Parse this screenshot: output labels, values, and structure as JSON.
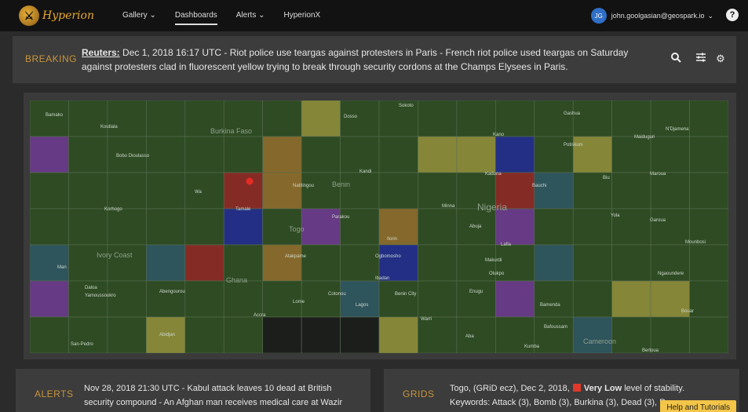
{
  "app": {
    "logo_text": "Hyperion"
  },
  "nav": [
    {
      "label": "Gallery",
      "dropdown": true
    },
    {
      "label": "Dashboards",
      "active": true
    },
    {
      "label": "Alerts",
      "dropdown": true
    },
    {
      "label": "HyperionX"
    }
  ],
  "user": {
    "initials": "JG",
    "email": "john.goolgasian@geospark.io"
  },
  "help_icon": "?",
  "breaking": {
    "label": "BREAKING",
    "source": "Reuters:",
    "text": " Dec 1, 2018 16:17 UTC - Riot police use teargas against protesters in Paris - French riot police used teargas on Saturday against protesters clad in fluorescent yellow trying to break through security cordons at the Champs Elysees in Paris.",
    "tools": [
      "search-icon",
      "sliders-icon",
      "gear-icon"
    ]
  },
  "map": {
    "colors": {
      "base": "#2f4c25",
      "yellow": "#8a8a3a",
      "orange": "#8a6a2c",
      "purple": "#6a3a8a",
      "blue": "#232e8a",
      "red": "#8a2a26",
      "teal": "#2e5560",
      "black": "#1c1c1c"
    },
    "cells": [
      [
        "base",
        "base",
        "base",
        "base",
        "base",
        "base",
        "base",
        "yellow",
        "base",
        "base",
        "base",
        "base",
        "base",
        "base",
        "base",
        "base",
        "base",
        "base"
      ],
      [
        "purple",
        "base",
        "base",
        "base",
        "base",
        "base",
        "orange",
        "base",
        "base",
        "base",
        "yellow",
        "yellow",
        "blue",
        "base",
        "yellow",
        "base",
        "base",
        "base"
      ],
      [
        "base",
        "base",
        "base",
        "base",
        "base",
        "red",
        "orange",
        "base",
        "base",
        "base",
        "base",
        "base",
        "red",
        "teal",
        "base",
        "base",
        "base",
        "base"
      ],
      [
        "base",
        "base",
        "base",
        "base",
        "base",
        "blue",
        "base",
        "purple",
        "base",
        "orange",
        "base",
        "base",
        "purple",
        "base",
        "base",
        "base",
        "base",
        "base"
      ],
      [
        "teal",
        "base",
        "base",
        "teal",
        "red",
        "base",
        "orange",
        "base",
        "base",
        "blue",
        "base",
        "base",
        "base",
        "teal",
        "base",
        "base",
        "base",
        "base"
      ],
      [
        "purple",
        "base",
        "base",
        "base",
        "base",
        "base",
        "base",
        "base",
        "teal",
        "base",
        "base",
        "base",
        "purple",
        "base",
        "base",
        "yellow",
        "yellow",
        "base"
      ],
      [
        "base",
        "base",
        "base",
        "yellow",
        "base",
        "base",
        "black",
        "black",
        "black",
        "yellow",
        "base",
        "base",
        "base",
        "base",
        "teal",
        "base",
        "base",
        "base"
      ]
    ],
    "labels": [
      "Bamako",
      "Koutiala",
      "Bobo Dioulasso",
      "Burkina Faso",
      "Sokoto",
      "Gashua",
      "N'Djamena",
      "Dosso",
      "Kano",
      "Potiskum",
      "Maiduguri",
      "Kandi",
      "Kaduna",
      "Bauchi",
      "Biu",
      "Maroua",
      "Wa",
      "Natitingou",
      "Benin",
      "Tamale",
      "Korhogo",
      "Togo",
      "Parakou",
      "Minna",
      "Nigeria",
      "Abuja",
      "Yola",
      "Garoua",
      "Ivory Coast",
      "Ilorin",
      "Lafia",
      "Mounbosi",
      "Man",
      "Atakpame",
      "Ogbomosho",
      "Makurdi",
      "Otukpo",
      "Ngaoundere",
      "Ghana",
      "Ibadan",
      "Daloa",
      "Yamoussoukro",
      "Abengourou",
      "Cotonou",
      "Lome",
      "Lagos",
      "Benin City",
      "Enugu",
      "Bamenda",
      "Accra",
      "Warri",
      "Aba",
      "Bafoussam",
      "Bouar",
      "Abidjan",
      "San-Pedro",
      "Kumba",
      "Cameroon",
      "Bertoua"
    ],
    "marker_color": "#e52b23"
  },
  "alerts": {
    "label": "ALERTS",
    "text_line1": "Nov 28, 2018 21:30 UTC - Kabul attack leaves 10 dead at British",
    "text_line2": "security compound - An Afghan man receives medical care at Wazir"
  },
  "grids": {
    "label": "GRIDS",
    "line1_prefix": "Togo, (GRiD ecz), Dec 2, 2018,",
    "stability_level": "Very Low",
    "line1_suffix": "level of stability.",
    "line2": "Keywords: Attack (3), Bomb (3), Burkina (3), Dead (3), R"
  },
  "help_tab": "Help and Tutorials"
}
